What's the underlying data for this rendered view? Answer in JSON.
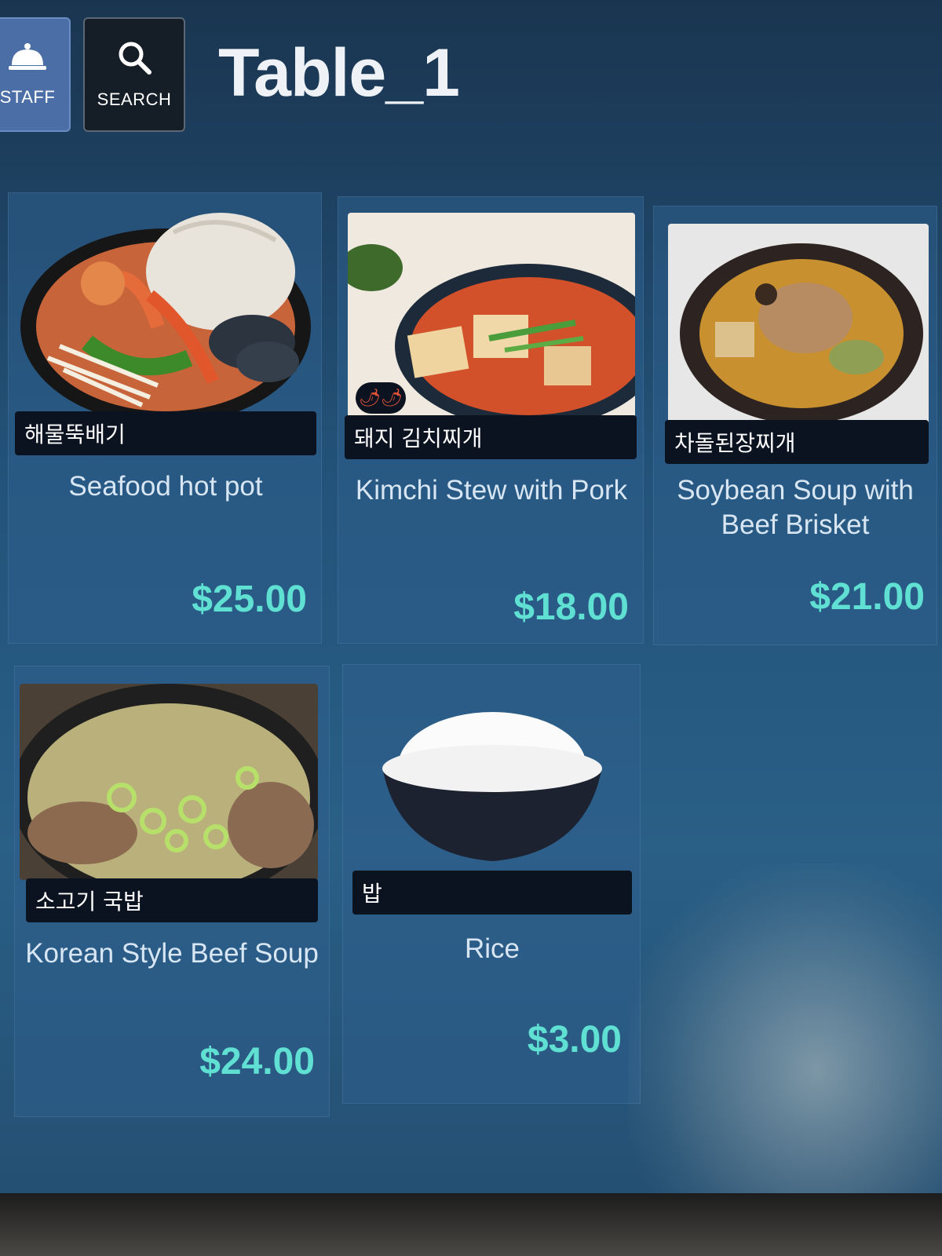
{
  "header": {
    "staff_label": "STAFF",
    "search_label": "SEARCH",
    "title": "Table_1"
  },
  "menu": [
    {
      "korean": "해물뚝배기",
      "english": "Seafood hot pot",
      "price": "$25.00",
      "image": "seafood-hot-pot-photo"
    },
    {
      "korean": "돼지 김치찌개",
      "english": "Kimchi Stew with Pork",
      "price": "$18.00",
      "image": "kimchi-stew-photo",
      "spicy": true
    },
    {
      "korean": "차돌된장찌개",
      "english": "Soybean Soup with Beef Brisket",
      "price": "$21.00",
      "image": "soybean-soup-photo"
    },
    {
      "korean": "소고기 국밥",
      "english": "Korean Style Beef Soup",
      "price": "$24.00",
      "image": "beef-soup-photo"
    },
    {
      "korean": "밥",
      "english": "Rice",
      "price": "$3.00",
      "image": "rice-bowl-photo"
    }
  ],
  "colors": {
    "price": "#5fe0d2",
    "staff_button": "#4b6ea6",
    "search_button": "#151d26"
  }
}
